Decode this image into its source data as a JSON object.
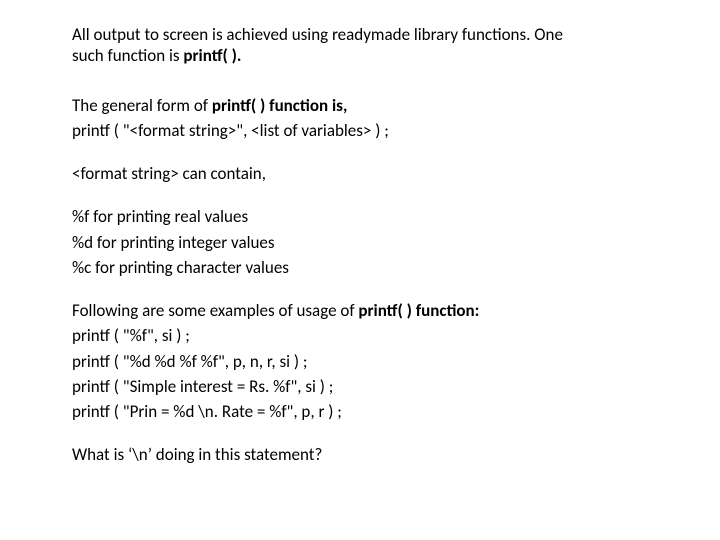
{
  "intro": {
    "line1_pre": "All output to screen is achieved using readymade library functions. One",
    "line2_pre": "such function is ",
    "line2_bold": "printf( ).",
    "line2_post": ""
  },
  "general_form": {
    "line1_pre": "The general form of ",
    "line1_bold": "printf( ) function is,",
    "line2": "printf ( \"<format string>\", <list of variables> ) ;"
  },
  "can_contain": {
    "line": "<format string> can contain,"
  },
  "specifiers": {
    "s1": "%f for printing real values",
    "s2": "%d for printing integer values",
    "s3": "%c for printing character values"
  },
  "examples": {
    "intro_pre": "Following are some examples of usage of ",
    "intro_bold": "printf( ) function:",
    "e1": "printf ( \"%f\", si ) ;",
    "e2": "printf ( \"%d %d %f %f\", p, n, r, si ) ;",
    "e3": "printf ( \"Simple interest = Rs. %f\", si ) ;",
    "e4": "printf ( \"Prin = %d \\n. Rate = %f\", p, r ) ;"
  },
  "question": {
    "line": "What is ‘\\n’ doing in this statement?"
  }
}
